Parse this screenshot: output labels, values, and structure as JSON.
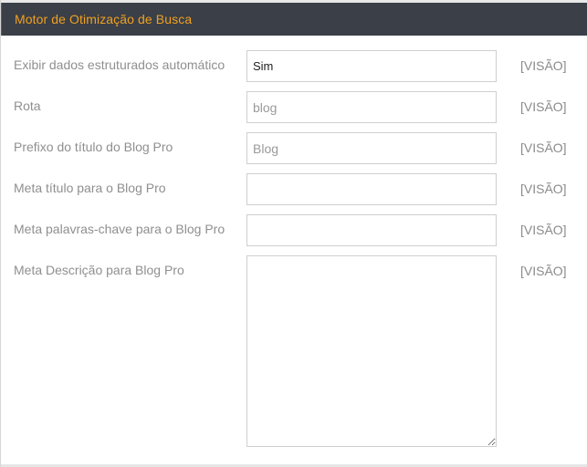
{
  "header": {
    "title": "Motor de Otimização de Busca"
  },
  "fields": [
    {
      "label": "Exibir dados estruturados automático",
      "value": "Sim",
      "scope": "[VISÃO]"
    },
    {
      "label": "Rota",
      "value": "blog",
      "scope": "[VISÃO]"
    },
    {
      "label": "Prefixo do título do Blog Pro",
      "value": "Blog",
      "scope": "[VISÃO]"
    },
    {
      "label": "Meta título para o Blog Pro",
      "value": "",
      "scope": "[VISÃO]"
    },
    {
      "label": "Meta palavras-chave para o Blog Pro",
      "value": "",
      "scope": "[VISÃO]"
    },
    {
      "label": "Meta Descrição para Blog Pro",
      "value": "",
      "scope": "[VISÃO]"
    }
  ],
  "colors": {
    "header_bg": "#3a3f48",
    "header_text": "#f0a020",
    "label_text": "#8f8f8f"
  }
}
